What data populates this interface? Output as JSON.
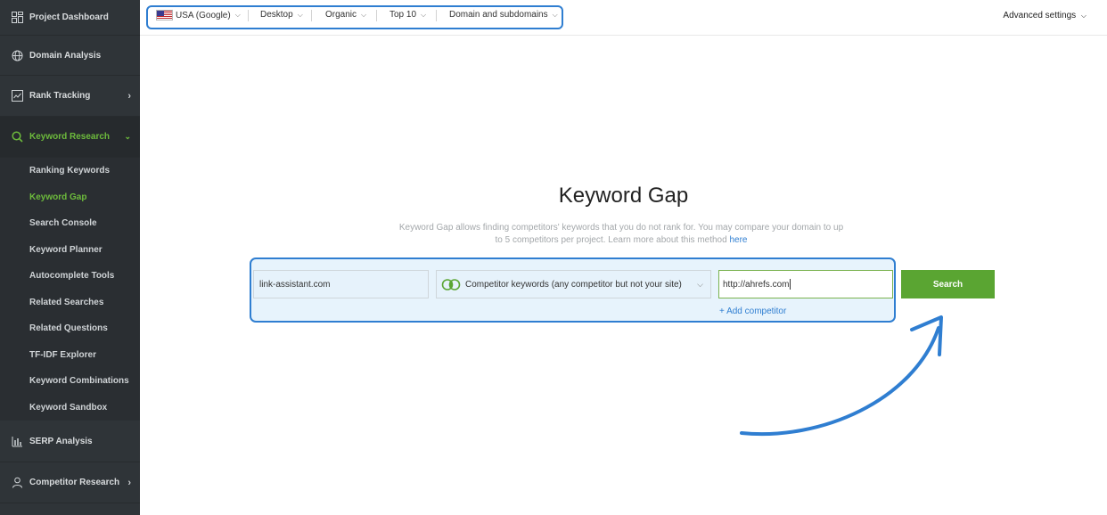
{
  "sidebar": {
    "items": [
      {
        "label": "Project Dashboard",
        "icon": "dashboard-icon"
      },
      {
        "label": "Domain Analysis",
        "icon": "globe-icon"
      },
      {
        "label": "Rank Tracking",
        "icon": "chart-line-icon"
      },
      {
        "label": "Keyword Research",
        "icon": "search-icon"
      },
      {
        "label": "SERP Analysis",
        "icon": "bar-chart-icon"
      },
      {
        "label": "Competitor Research",
        "icon": "user-icon"
      }
    ],
    "subitems": [
      "Ranking Keywords",
      "Keyword Gap",
      "Search Console",
      "Keyword Planner",
      "Autocomplete Tools",
      "Related Searches",
      "Related Questions",
      "TF-IDF Explorer",
      "Keyword Combinations",
      "Keyword Sandbox"
    ]
  },
  "topbar": {
    "filters": [
      "USA (Google)",
      "Desktop",
      "Organic",
      "Top 10",
      "Domain and subdomains"
    ],
    "advanced": "Advanced settings"
  },
  "main": {
    "title": "Keyword Gap",
    "description": "Keyword Gap allows finding competitors' keywords that you do not rank for. You may compare your domain to up to 5 competitors per project. Learn more about this method",
    "link": "here",
    "domain_value": "link-assistant.com",
    "mode_value": "Competitor keywords (any competitor but not your site)",
    "competitor_value": "http://ahrefs.com",
    "add_competitor": "+ Add competitor",
    "search_label": "Search"
  },
  "colors": {
    "accent_green": "#5aa532",
    "highlight_blue": "#2f7ed1",
    "sidebar_bg": "#2f3438"
  }
}
